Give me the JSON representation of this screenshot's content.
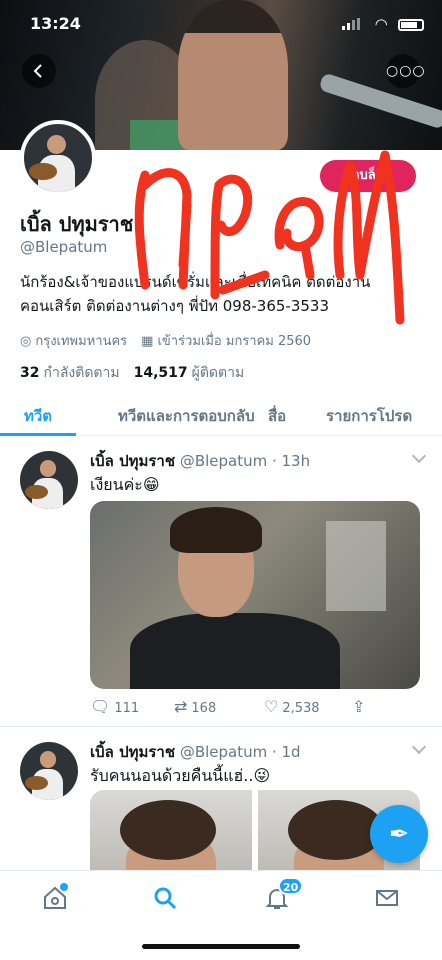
{
  "status_bar": {
    "time": "13:24"
  },
  "profile": {
    "blocked_label": "ถูกบล็อค",
    "display_name": "เบิ้ล ปทุมราช",
    "handle": "@Blepatum",
    "bio_line1": "นักร้อง&เจ้าของแบรนด์เซรั่มและเชื่อเทคนิค ติดต่องาน",
    "bio_line2": "คอนเสิร์ต ติดต่องานต่างๆ พี่ปัท 098-365-3533",
    "location": "กรุงเทพมหานคร",
    "joined": "เข้าร่วมเมื่อ มกราคม 2560",
    "following_count": "32",
    "following_label": "กำลังติดตาม",
    "followers_count": "14,517",
    "followers_label": "ผู้ติดตาม",
    "overlay_text": "ปลอม"
  },
  "tabs": [
    {
      "label": "ทวีต",
      "active": true
    },
    {
      "label": "ทวีตและการตอบกลับ",
      "active": false
    },
    {
      "label": "สื่อ",
      "active": false
    },
    {
      "label": "รายการโปรด",
      "active": false
    }
  ],
  "tweets": [
    {
      "name": "เบิ้ล ปทุมราช",
      "handle_time": "@Blepatum · 13h",
      "text": "เงียนค่ะ😁",
      "replies": "111",
      "retweets": "168",
      "likes": "2,538"
    },
    {
      "name": "เบิ้ล ปทุมราช",
      "handle_time": "@Blepatum · 1d",
      "text": "รับคนนอนด้วยคืนนี้แฮ่..😜"
    }
  ],
  "nav": {
    "notification_count": "20"
  },
  "colors": {
    "accent": "#1da1f2",
    "blocked": "#e0245e",
    "overlay": "#f0321e"
  }
}
